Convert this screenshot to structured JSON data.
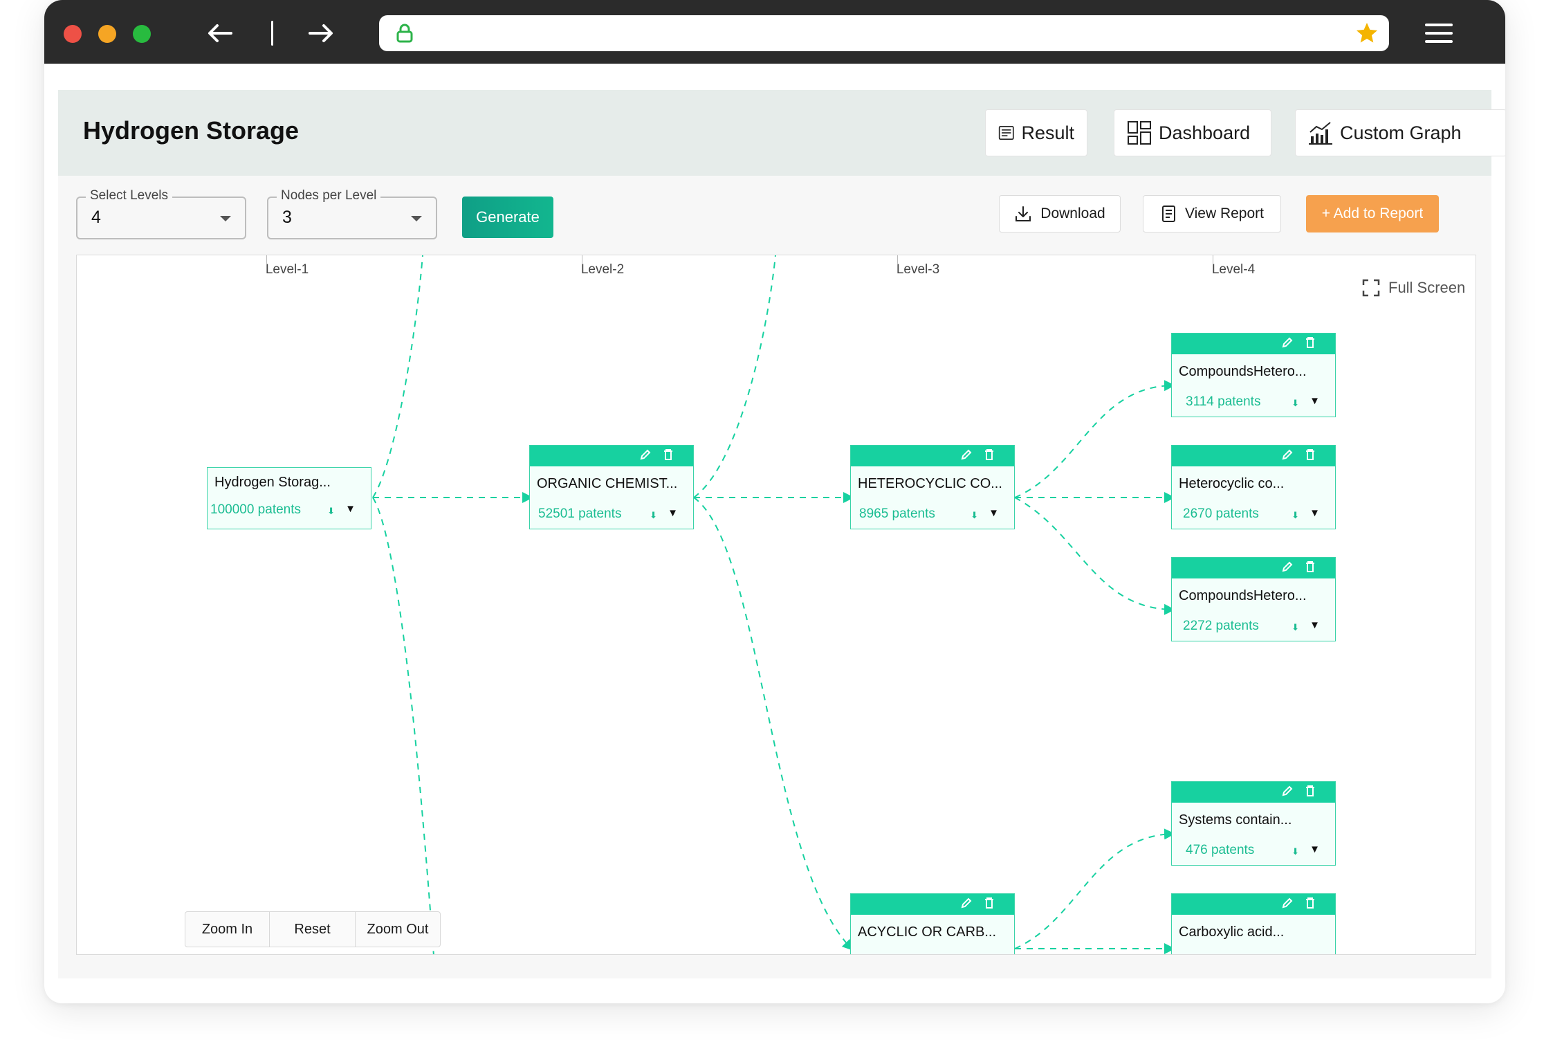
{
  "colors": {
    "brand": "#17d1a0",
    "generate": "#12a98a",
    "add_report": "#f6a14e",
    "chrome": "#2b2b2b",
    "star": "#f4b400",
    "lock": "#2db34a"
  },
  "browser": {
    "url": "",
    "icons": [
      "back-arrow-icon",
      "forward-arrow-icon",
      "lock-icon",
      "star-icon",
      "hamburger-menu-icon"
    ]
  },
  "header": {
    "title": "Hydrogen Storage",
    "buttons": {
      "result": "Result",
      "dashboard": "Dashboard",
      "custom_graph": "Custom Graph"
    }
  },
  "controls": {
    "levels": {
      "label": "Select Levels",
      "value": "4"
    },
    "nodes": {
      "label": "Nodes per Level",
      "value": "3"
    },
    "generate": "Generate",
    "download": "Download",
    "view_report": "View Report",
    "add_report": "+ Add to Report"
  },
  "graph": {
    "levels": [
      "Level-1",
      "Level-2",
      "Level-3",
      "Level-4"
    ],
    "fullscreen": "Full Screen",
    "zoom": {
      "in": "Zoom In",
      "reset": "Reset",
      "out": "Zoom Out"
    },
    "nodes": [
      {
        "level": 1,
        "title": "Hydrogen Storag...",
        "count": "100000 patents"
      },
      {
        "level": 2,
        "title": "ORGANIC CHEMIST...",
        "count": "52501 patents"
      },
      {
        "level": 3,
        "title": "HETEROCYCLIC CO...",
        "count": "8965 patents"
      },
      {
        "level": 3,
        "title": "ACYCLIC OR CARB...",
        "count": ""
      },
      {
        "level": 4,
        "title": "CompoundsHetero...",
        "count": "3114 patents"
      },
      {
        "level": 4,
        "title": "Heterocyclic co...",
        "count": "2670 patents"
      },
      {
        "level": 4,
        "title": "CompoundsHetero...",
        "count": "2272 patents"
      },
      {
        "level": 4,
        "title": "Systems contain...",
        "count": "476 patents"
      },
      {
        "level": 4,
        "title": "Carboxylic acid...",
        "count": ""
      }
    ]
  }
}
